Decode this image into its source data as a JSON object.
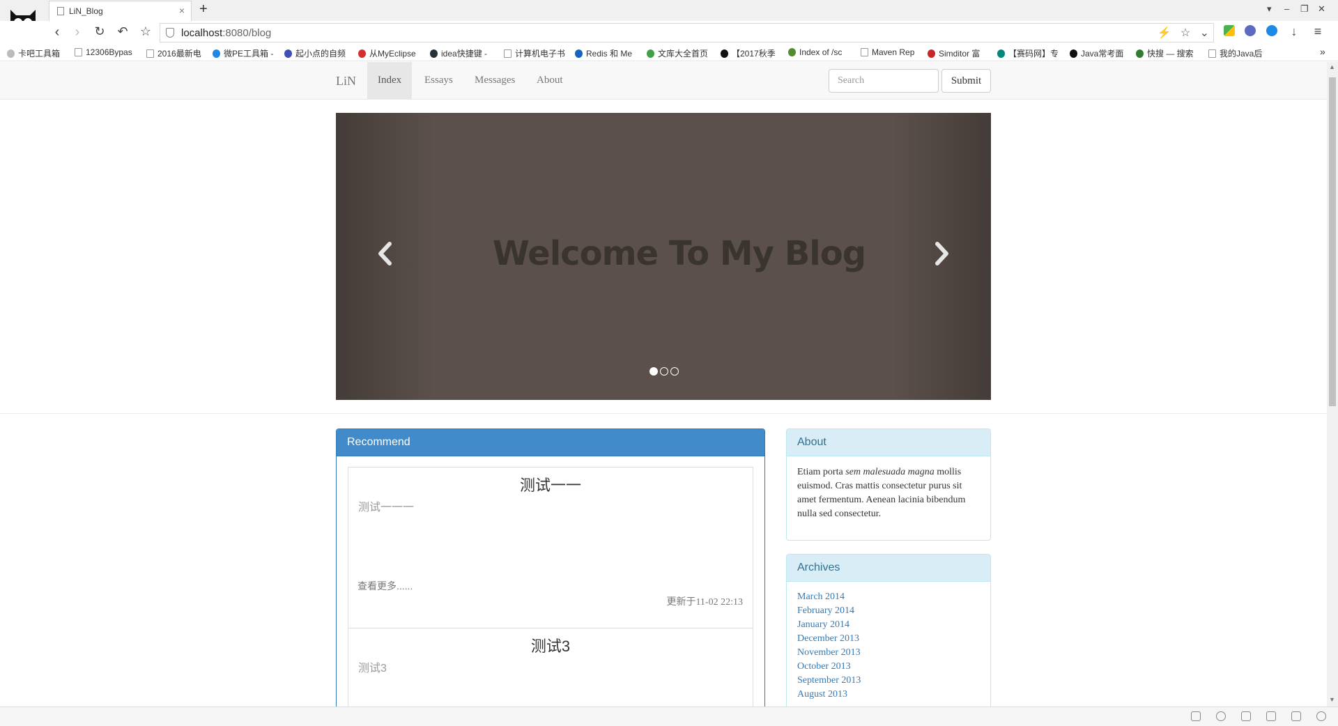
{
  "browser": {
    "tab_title": "LiN_Blog",
    "tab_close": "×",
    "new_tab": "+",
    "url_host": "localhost",
    "url_rest": ":8080/blog",
    "window_controls": [
      "▾",
      "–",
      "❐",
      "✕"
    ],
    "bookmarks": [
      {
        "label": "卡吧工具箱",
        "icon": "circle",
        "color": "#bbbbbb"
      },
      {
        "label": "12306Bypas",
        "icon": "page",
        "color": "#999999"
      },
      {
        "label": "2016最新电",
        "icon": "page",
        "color": "#999999"
      },
      {
        "label": "微PE工具箱 -",
        "icon": "circle",
        "color": "#1e88e5"
      },
      {
        "label": "起小点的自频",
        "icon": "circle",
        "color": "#3f51b5"
      },
      {
        "label": "从MyEclipse",
        "icon": "circle",
        "color": "#d32f2f"
      },
      {
        "label": "idea快捷键 -",
        "icon": "circle",
        "color": "#263238"
      },
      {
        "label": "计算机电子书",
        "icon": "page",
        "color": "#999999"
      },
      {
        "label": "Redis 和 Me",
        "icon": "circle",
        "color": "#1565c0"
      },
      {
        "label": "文库大全首页",
        "icon": "circle",
        "color": "#43a047"
      },
      {
        "label": "【2017秋季",
        "icon": "circle",
        "color": "#111111"
      },
      {
        "label": "Index of /sc",
        "icon": "circle",
        "color": "#558b2f"
      },
      {
        "label": "Maven Rep",
        "icon": "page",
        "color": "#999999"
      },
      {
        "label": "Simditor 富",
        "icon": "circle",
        "color": "#c62828"
      },
      {
        "label": "【赛码网】专",
        "icon": "circle",
        "color": "#00897b"
      },
      {
        "label": "Java常考面",
        "icon": "circle",
        "color": "#111111"
      },
      {
        "label": "快搜 — 搜索",
        "icon": "circle",
        "color": "#2e7d32"
      },
      {
        "label": "我的Java后",
        "icon": "page",
        "color": "#999999"
      }
    ],
    "bookmarks_overflow": "»"
  },
  "blog": {
    "brand": "LiN",
    "nav": [
      "Index",
      "Essays",
      "Messages",
      "About"
    ],
    "active_nav": "Index",
    "search_placeholder": "Search",
    "submit_label": "Submit",
    "carousel": {
      "headline": "Welcome To My Blog",
      "slide_count": 3,
      "active_slide": 1
    },
    "recommend": {
      "heading": "Recommend",
      "posts": [
        {
          "title": "测试一一",
          "excerpt": "测试一一一",
          "more": "查看更多......",
          "updated": "更新于11-02 22:13"
        },
        {
          "title": "测试3",
          "excerpt": "测试3"
        }
      ]
    },
    "about": {
      "heading": "About",
      "text_1": "Etiam porta ",
      "text_em": "sem malesuada magna",
      "text_2": " mollis euismod. Cras mattis consectetur purus sit amet fermentum. Aenean lacinia bibendum nulla sed consectetur."
    },
    "archives": {
      "heading": "Archives",
      "items": [
        "March 2014",
        "February 2014",
        "January 2014",
        "December 2013",
        "November 2013",
        "October 2013",
        "September 2013",
        "August 2013"
      ]
    }
  },
  "colors": {
    "primary": "#428bca",
    "carousel_bg": "#5b504b",
    "link": "#337ab7"
  }
}
